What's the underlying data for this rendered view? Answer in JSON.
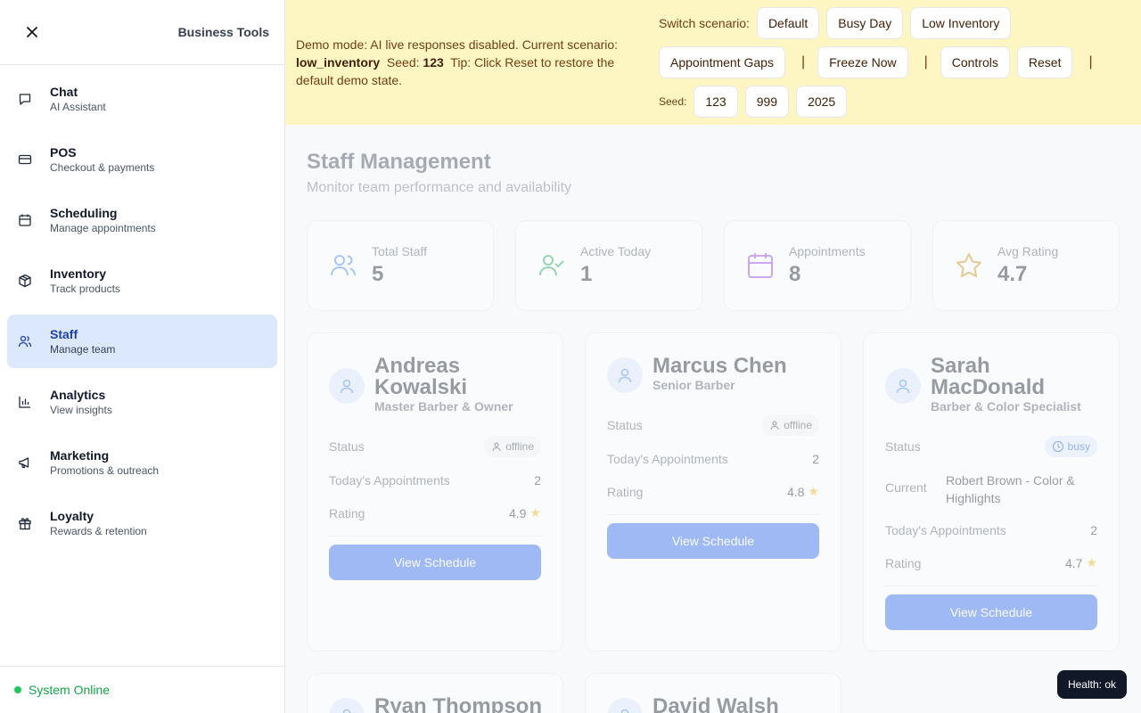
{
  "sidebar": {
    "title": "Business Tools",
    "items": [
      {
        "label": "Chat",
        "sub": "AI Assistant",
        "icon": "chat-icon"
      },
      {
        "label": "POS",
        "sub": "Checkout & payments",
        "icon": "credit-card-icon"
      },
      {
        "label": "Scheduling",
        "sub": "Manage appointments",
        "icon": "calendar-icon"
      },
      {
        "label": "Inventory",
        "sub": "Track products",
        "icon": "package-icon"
      },
      {
        "label": "Staff",
        "sub": "Manage team",
        "icon": "users-icon"
      },
      {
        "label": "Analytics",
        "sub": "View insights",
        "icon": "bar-chart-icon"
      },
      {
        "label": "Marketing",
        "sub": "Promotions & outreach",
        "icon": "megaphone-icon"
      },
      {
        "label": "Loyalty",
        "sub": "Rewards & retention",
        "icon": "gift-icon"
      }
    ],
    "active_index": 4,
    "footer_status": "System Online"
  },
  "banner": {
    "info_prefix": "Demo mode: AI live responses disabled. Current scenario:",
    "scenario": "low_inventory",
    "seed_label": "Seed:",
    "seed_value": "123",
    "tip": "Tip: Click Reset to restore the default demo state.",
    "switch_label": "Switch scenario:",
    "scenarios": [
      "Default",
      "Busy Day",
      "Low Inventory"
    ],
    "actions": [
      "Appointment Gaps",
      "Freeze Now",
      "Controls",
      "Reset"
    ],
    "separator": "|",
    "seed_row_label": "Seed:",
    "seeds": [
      "123",
      "999",
      "2025"
    ]
  },
  "main": {
    "title": "Staff Management",
    "subtitle": "Monitor team performance and availability",
    "stats": [
      {
        "label": "Total Staff",
        "value": "5",
        "icon": "users-icon",
        "color": "#3b82f6"
      },
      {
        "label": "Active Today",
        "value": "1",
        "icon": "user-check-icon",
        "color": "#16a34a"
      },
      {
        "label": "Appointments",
        "value": "8",
        "icon": "calendar-icon",
        "color": "#9333ea"
      },
      {
        "label": "Avg Rating",
        "value": "4.7",
        "icon": "star-icon",
        "color": "#ca8a04"
      }
    ],
    "labels": {
      "status": "Status",
      "current": "Current",
      "appointments": "Today's Appointments",
      "rating": "Rating",
      "view": "View Schedule"
    },
    "staff": [
      {
        "name": "Andreas Kowalski",
        "role": "Master Barber & Owner",
        "status": "offline",
        "appointments": "2",
        "rating": "4.9"
      },
      {
        "name": "Marcus Chen",
        "role": "Senior Barber",
        "status": "offline",
        "appointments": "2",
        "rating": "4.8"
      },
      {
        "name": "Sarah MacDonald",
        "role": "Barber & Color Specialist",
        "status": "busy",
        "current": "Robert Brown - Color & Highlights",
        "appointments": "2",
        "rating": "4.7"
      },
      {
        "name": "Ryan Thompson"
      },
      {
        "name": "David Walsh"
      }
    ]
  },
  "health": "Health: ok",
  "colors": {
    "accent": "#2563eb",
    "banner": "#fdf6c3",
    "active_nav": "#dbe8fe"
  }
}
